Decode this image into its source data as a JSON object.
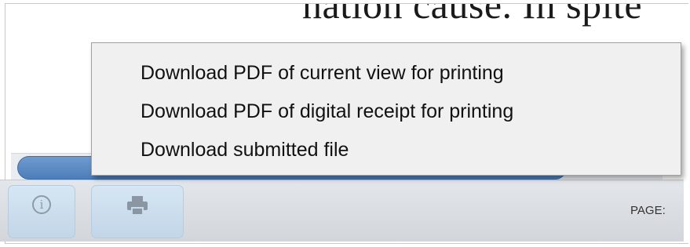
{
  "document": {
    "visible_text": "nation cause. In spite"
  },
  "menu": {
    "items": [
      {
        "label": "Download PDF of current view for printing"
      },
      {
        "label": "Download PDF of digital receipt for printing"
      },
      {
        "label": "Download submitted file"
      }
    ]
  },
  "toolbar": {
    "info_icon": "info-icon",
    "print_icon": "printer-icon",
    "page_label": "PAGE:"
  },
  "colors": {
    "menu_background": "#f0f0f0",
    "scroll_thumb": "#5a88c2",
    "toolbar_button": "#c8dbec"
  }
}
